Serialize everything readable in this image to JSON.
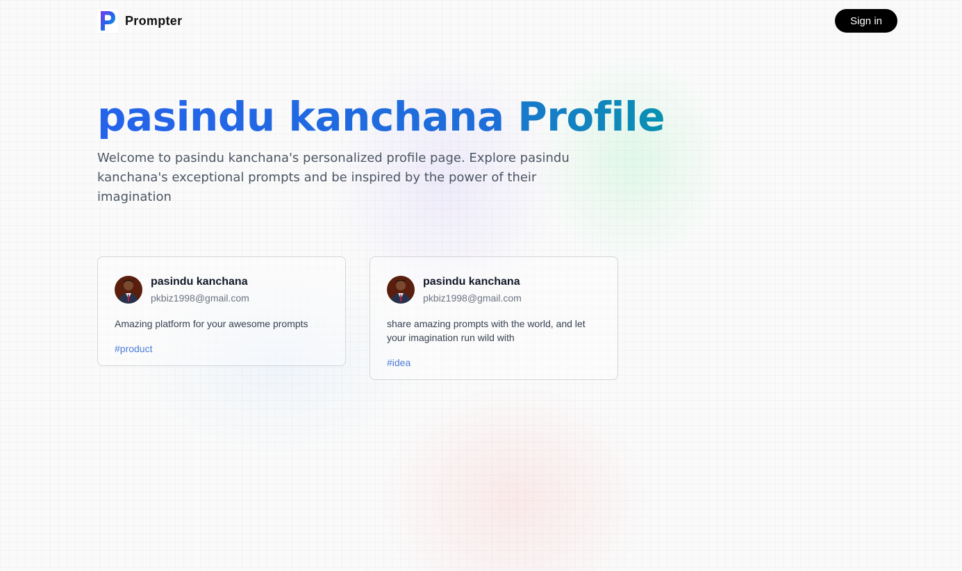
{
  "brand": {
    "name": "Prompter",
    "logo_icon": "prompter-logo-icon"
  },
  "nav": {
    "signin_label": "Sign in"
  },
  "profile": {
    "title_name": "pasindu kanchana",
    "title_suffix": "Profile",
    "description": "Welcome to pasindu kanchana's personalized profile page. Explore pasindu kanchana's exceptional prompts and be inspired by the power of their imagination"
  },
  "prompts": [
    {
      "username": "pasindu kanchana",
      "email": "pkbiz1998@gmail.com",
      "text": "Amazing platform for your awesome prompts",
      "tag": "#product"
    },
    {
      "username": "pasindu kanchana",
      "email": "pkbiz1998@gmail.com",
      "text": "share amazing prompts with the world, and let your imagination run wild with",
      "tag": "#idea"
    }
  ],
  "colors": {
    "title_gradient_start": "#2563eb",
    "title_gradient_end": "#0891b2",
    "tag_color": "#4b7bd8",
    "signin_bg": "#000000"
  }
}
